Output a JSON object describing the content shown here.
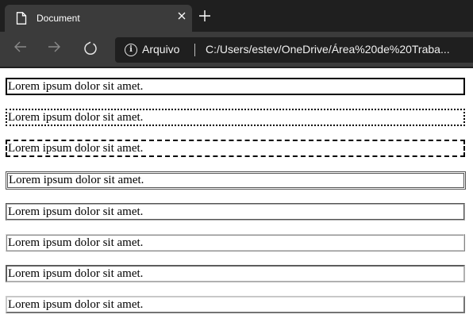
{
  "browser": {
    "tab": {
      "title": "Document"
    },
    "address": {
      "site_label": "Arquivo",
      "url": "C:/Users/estev/OneDrive/Área%20de%20Traba..."
    },
    "icons": [
      "document-icon",
      "close-icon",
      "plus-icon",
      "back-arrow-icon",
      "forward-arrow-icon",
      "refresh-icon",
      "info-icon"
    ]
  },
  "page": {
    "paragraphs": [
      {
        "text": "Lorem ipsum dolor sit amet.",
        "border_style": "solid"
      },
      {
        "text": "Lorem ipsum dolor sit amet.",
        "border_style": "dotted"
      },
      {
        "text": "Lorem ipsum dolor sit amet.",
        "border_style": "dashed"
      },
      {
        "text": "Lorem ipsum dolor sit amet.",
        "border_style": "double"
      },
      {
        "text": "Lorem ipsum dolor sit amet.",
        "border_style": "groove"
      },
      {
        "text": "Lorem ipsum dolor sit amet.",
        "border_style": "ridge"
      },
      {
        "text": "Lorem ipsum dolor sit amet.",
        "border_style": "inset"
      },
      {
        "text": "Lorem ipsum dolor sit amet.",
        "border_style": "outset"
      }
    ]
  },
  "colors": {
    "chrome_dark": "#1f1f1f",
    "chrome_tab": "#3b3b3b",
    "page_bg": "#ffffff",
    "text": "#000000"
  }
}
